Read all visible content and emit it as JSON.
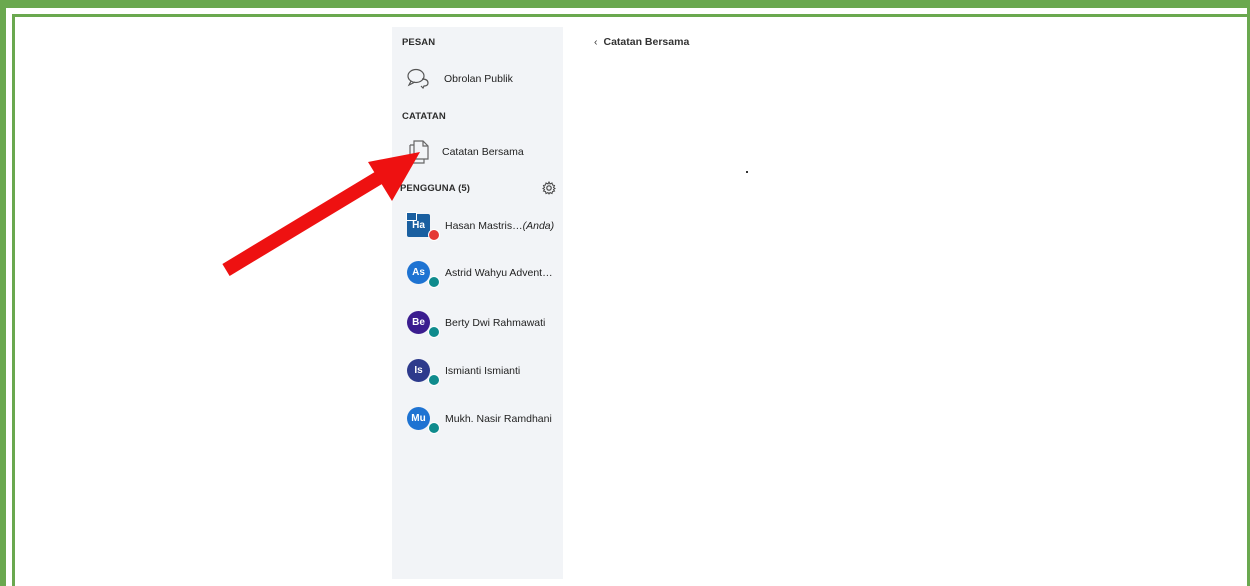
{
  "sidebar": {
    "messages_title": "PESAN",
    "public_chat_label": "Obrolan Publik",
    "notes_title": "CATATAN",
    "shared_notes_label": "Catatan Bersama",
    "users_title": "PENGGUNA (5)",
    "users": [
      {
        "initials": "Ha",
        "name": "Hasan Mastris…",
        "suffix": "(Anda)",
        "color": "#1a5fa0",
        "status_color": "#e53935"
      },
      {
        "initials": "As",
        "name": "Astrid Wahyu Advent…",
        "suffix": "",
        "color": "#1e73d2",
        "status_color": "#0f8b8d"
      },
      {
        "initials": "Be",
        "name": "Berty Dwi Rahmawati",
        "suffix": "",
        "color": "#3b1d8f",
        "status_color": "#0f8b8d"
      },
      {
        "initials": "Is",
        "name": "Ismianti Ismianti",
        "suffix": "",
        "color": "#2d3a8c",
        "status_color": "#0f8b8d"
      },
      {
        "initials": "Mu",
        "name": "Mukh. Nasir Ramdhani",
        "suffix": "",
        "color": "#1e73d2",
        "status_color": "#0f8b8d"
      }
    ]
  },
  "panel": {
    "title": "Catatan Bersama"
  },
  "colors": {
    "frame": "#6aa84f",
    "sidebar_bg": "#f2f4f7",
    "arrow": "#ee1111"
  }
}
